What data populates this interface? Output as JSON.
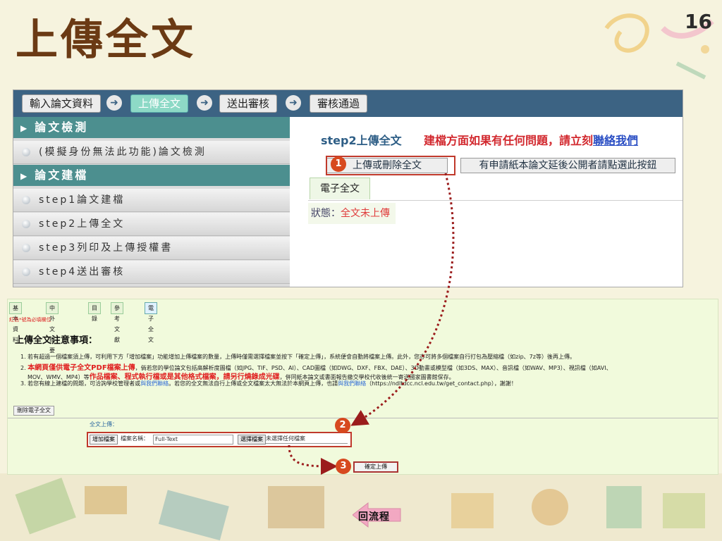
{
  "slide": {
    "title": "上傳全文",
    "page_number": "16"
  },
  "top_screenshot": {
    "flow_steps": [
      {
        "label": "輸入論文資料",
        "active": false
      },
      {
        "label": "上傳全文",
        "active": true
      },
      {
        "label": "送出審核",
        "active": false
      },
      {
        "label": "審核通過",
        "active": false
      }
    ],
    "sidebar": {
      "sections": [
        {
          "heading": "論文檢測",
          "items": [
            "(模擬身份無法此功能)論文檢測"
          ]
        },
        {
          "heading": "論文建檔",
          "items": [
            "step1論文建檔",
            "step2上傳全文",
            "step3列印及上傳授權書",
            "step4送出審核"
          ]
        }
      ]
    },
    "main": {
      "step_title": "step2上傳全文",
      "warning_text": "建檔方面如果有任何問題，請立刻",
      "warning_link": "聯絡我們",
      "upload_delete_button": "上傳或刪除全文",
      "delay_button": "有申請紙本論文延後公開者請點選此按鈕",
      "tab_label": "電子全文",
      "status_label": "狀態：",
      "status_value": "全文未上傳"
    }
  },
  "bottom_screenshot": {
    "tabs": [
      "基本資料",
      "中外文摘要",
      "目錄",
      "參考文獻",
      "電子全文"
    ],
    "required_note": "紅色*號為必填欄位",
    "notice_heading": "上傳全文注意事項：",
    "notice_1": "1. 若有超過一個檔案須上傳，可利用下方「增加檔案」功能增加上傳檔案的數量，上傳時僅需選擇檔案並按下「確定上傳」，系統便會自動將檔案上傳。此外，您亦可將多個檔案自行打包為壓縮檔（如zip、7z等）後再上傳。",
    "notice_2_prefix": "2.",
    "notice_2_red1": "本網頁僅供電子全文PDF檔案上傳",
    "notice_2_mid": "，倘若您的學位論文包括高解析度圖檔（如JPG、TIF、PSD、AI）、CAD圖檔（如DWG、DXF、FBX、DAE）、3D動畫或模型檔（如3DS、MAX）、音訊檔（如WAV、MP3）、視訊檔（如AVI、",
    "notice_2_line2_a": "MOV、WMV、MP4）等",
    "notice_2_red2": "作品檔案、程式執行檔或是其他格式檔案，請另行燒錄成光碟",
    "notice_2_line2_b": "，併同紙本論文或書面報告繳交學校代收後統一寄送國家圖書館保存。",
    "notice_3_a": "3. 若您有線上建檔的問題，可洽詢學校管理者或",
    "notice_3_link1": "與我們聯絡",
    "notice_3_b": "。若您的全文無法自行上傳或全文檔案太大無法於本網頁上傳，也請",
    "notice_3_link2": "與我們聯絡",
    "notice_3_c": "（https://ndltdcc.ncl.edu.tw/get_contact.php），謝謝！",
    "delete_button": "刪除電子全文",
    "fulltext_label": "全文上傳：",
    "add_file_button": "增加檔案",
    "filename_label": "檔案名稱：",
    "filename_value": "Full-Text",
    "choose_file_button": "選擇檔案",
    "no_file_text": "未選擇任何檔案",
    "confirm_button": "確定上傳"
  },
  "annotations": {
    "badges": [
      "1",
      "2",
      "3"
    ],
    "back_button": "回流程"
  },
  "colors": {
    "title_brown": "#6b3a14",
    "header_blue": "#3c6383",
    "section_teal": "#4c8f8f",
    "active_step": "#8dd9c6",
    "highlight_red": "#c0392b",
    "badge_orange": "#d7491f",
    "back_pink": "#f2a8c2"
  }
}
